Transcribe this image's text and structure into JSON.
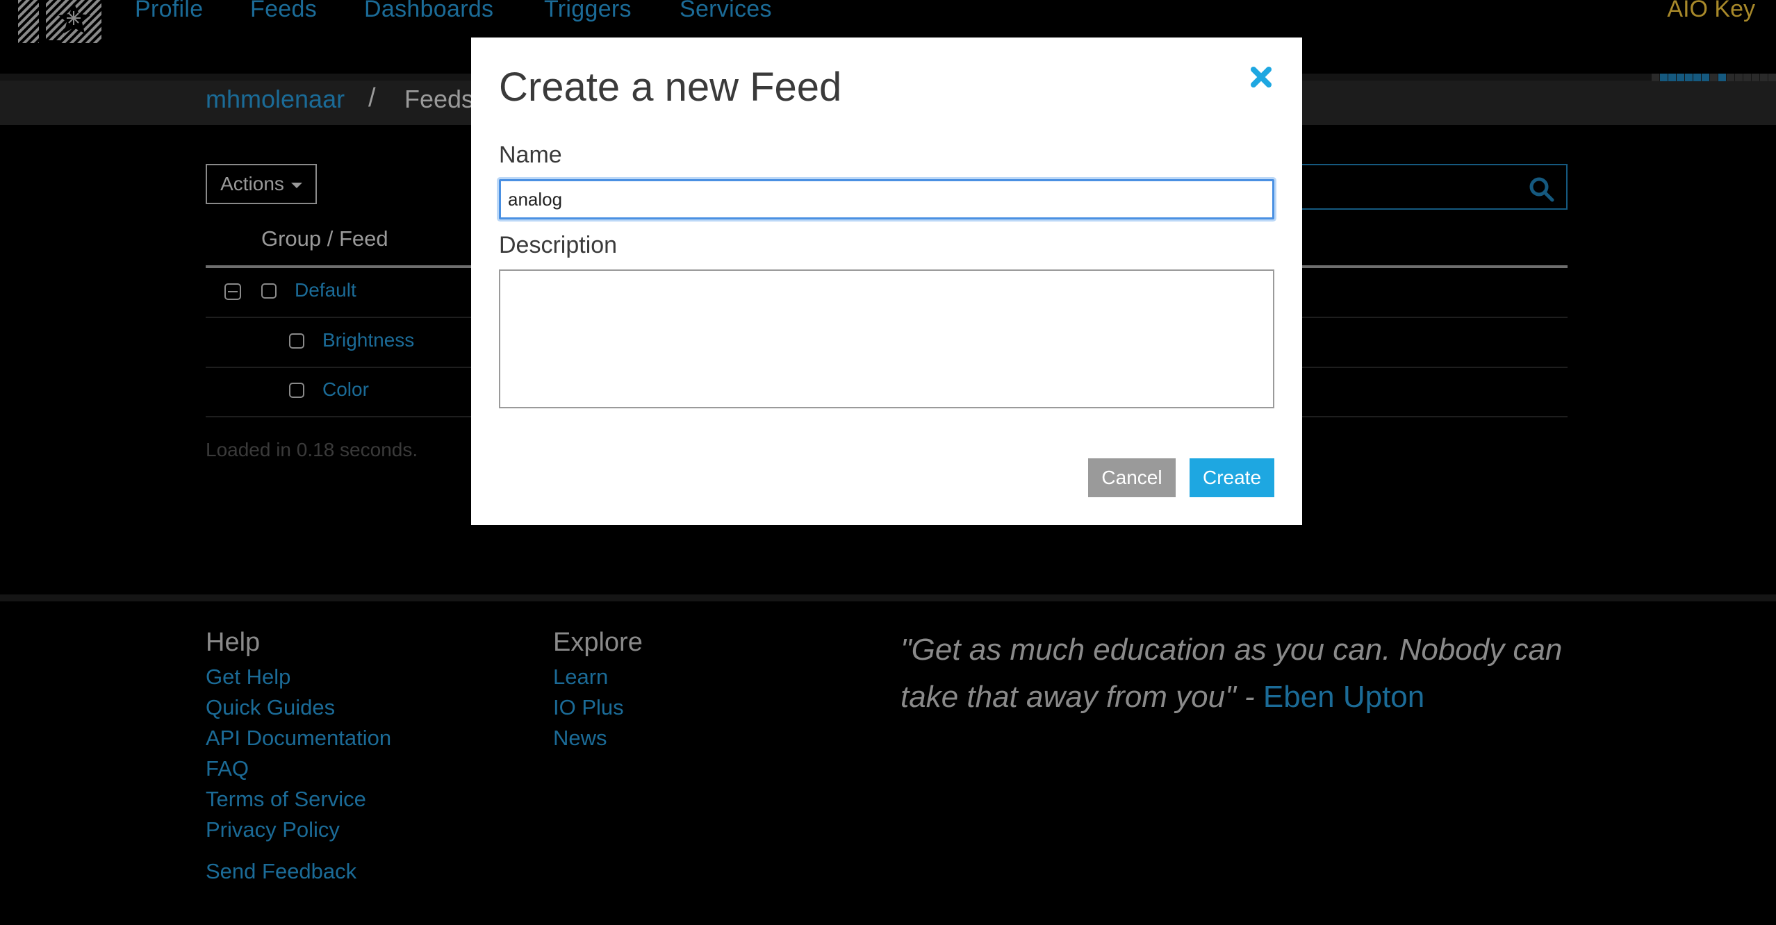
{
  "nav": {
    "items": [
      "Profile",
      "Feeds",
      "Dashboards",
      "Triggers",
      "Services"
    ],
    "aio_key": "AIO Key"
  },
  "breadcrumb": {
    "user": "mhmolenaar",
    "separator": "/",
    "page": "Feeds"
  },
  "activity_pixels": [
    0,
    1,
    1,
    1,
    1,
    1,
    1,
    0,
    1,
    0,
    0,
    0,
    0,
    0,
    0
  ],
  "toolbar": {
    "actions_label": "Actions"
  },
  "table": {
    "column_header": "Group / Feed",
    "group": "Default",
    "feeds": [
      "Brightness",
      "Color"
    ]
  },
  "status": {
    "loaded": "Loaded in 0.18 seconds."
  },
  "footer": {
    "help": {
      "heading": "Help",
      "links": [
        "Get Help",
        "Quick Guides",
        "API Documentation",
        "FAQ",
        "Terms of Service",
        "Privacy Policy"
      ],
      "feedback": "Send Feedback"
    },
    "explore": {
      "heading": "Explore",
      "links": [
        "Learn",
        "IO Plus",
        "News"
      ]
    },
    "quote": {
      "text": "\"Get as much education as you can. Nobody can take that away from you\" - ",
      "author": "Eben Upton"
    }
  },
  "modal": {
    "title": "Create a new Feed",
    "name_label": "Name",
    "name_value": "analog",
    "description_label": "Description",
    "description_value": "",
    "cancel_label": "Cancel",
    "create_label": "Create"
  },
  "colors": {
    "link": "#1b6b97",
    "accent": "#1ea7e1",
    "aio_key": "#a8892a"
  }
}
